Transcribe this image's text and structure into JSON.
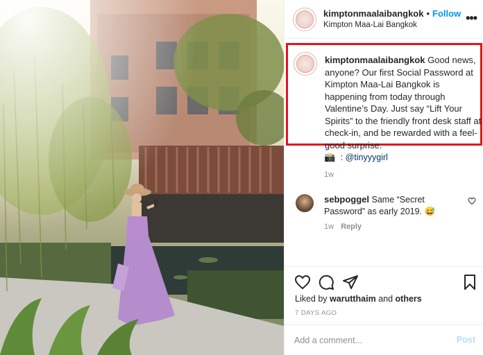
{
  "photo": {
    "description_icon": "post-photo"
  },
  "header": {
    "avatar_icon": "kimpton-logo-icon",
    "username": "kimptonmaalaibangkok",
    "separator": "•",
    "follow_label": "Follow",
    "location": "Kimpton Maa-Lai Bangkok",
    "more_icon": "more-options-icon",
    "more_glyph": "•••"
  },
  "caption": {
    "username": "kimptonmaalaibangkok",
    "text": " Good news, anyone? Our first Social Password at Kimpton Maa-Lai Bangkok is happening from today through Valentine’s Day. Just say “Lift Your Spirits” to the friendly front desk staff at check-in, and be rewarded with a feel-good surprise.",
    "credit_glyph": "📸",
    "credit_sep": " : ",
    "credit_mention": "@tinyyygirl",
    "age": "1w"
  },
  "comment": {
    "username": "sebpoggel",
    "text": " Same “Secret Password” as early 2019. 😅",
    "age": "1w",
    "reply_label": "Reply"
  },
  "actions": {
    "like_icon": "heart-icon",
    "comment_icon": "comment-icon",
    "share_icon": "share-icon",
    "save_icon": "bookmark-icon"
  },
  "likes": {
    "prefix": "Liked by ",
    "user": "warutthaim",
    "middle": " and ",
    "others": "others"
  },
  "date": "7 DAYS AGO",
  "add_comment": {
    "placeholder": "Add a comment...",
    "post_label": "Post"
  },
  "colors": {
    "highlight_border": "#e3131b",
    "follow": "#0095f6",
    "post_disabled": "#b2dffc",
    "muted": "#8e8e8e"
  }
}
